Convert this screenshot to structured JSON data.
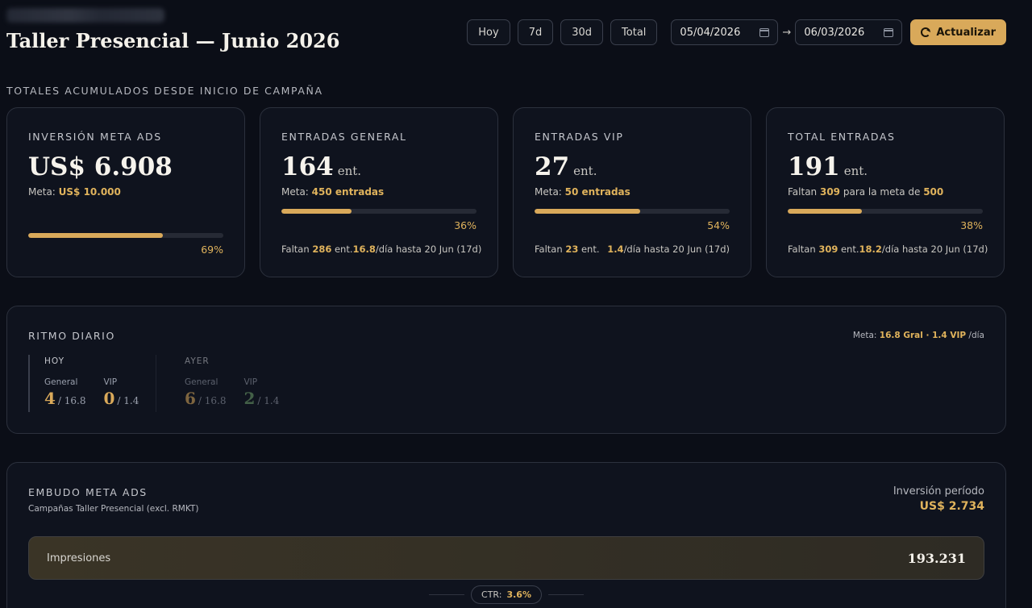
{
  "header": {
    "title": "Taller Presencial — Junio 2026",
    "range_buttons": [
      "Hoy",
      "7d",
      "30d",
      "Total"
    ],
    "date_from": "05/04/2026",
    "date_arrow": "→",
    "date_to": "06/03/2026",
    "refresh_label": "Actualizar"
  },
  "totals_label": "TOTALES ACUMULADOS DESDE INICIO DE CAMPAÑA",
  "cards": [
    {
      "label": "INVERSIÓN META ADS",
      "value": "US$ 6.908",
      "unit": "",
      "meta_prefix": "Meta: ",
      "meta_value": "US$ 10.000",
      "meta_suffix": "",
      "meta_value2": "",
      "progress": 0.69,
      "pct": "69%",
      "foot_left_prefix": "",
      "foot_left_value": "",
      "foot_left_suffix": "",
      "foot_right_value": "",
      "foot_right_suffix": ""
    },
    {
      "label": "ENTRADAS GENERAL",
      "value": "164",
      "unit": "ent.",
      "meta_prefix": "Meta: ",
      "meta_value": "450 entradas",
      "meta_suffix": "",
      "meta_value2": "",
      "progress": 0.36,
      "pct": "36%",
      "foot_left_prefix": "Faltan ",
      "foot_left_value": "286",
      "foot_left_suffix": " ent.",
      "foot_right_value": "16.8",
      "foot_right_suffix": "/día hasta 20 Jun (17d)"
    },
    {
      "label": "ENTRADAS VIP",
      "value": "27",
      "unit": "ent.",
      "meta_prefix": "Meta: ",
      "meta_value": "50 entradas",
      "meta_suffix": "",
      "meta_value2": "",
      "progress": 0.54,
      "pct": "54%",
      "foot_left_prefix": "Faltan ",
      "foot_left_value": "23",
      "foot_left_suffix": " ent.",
      "foot_right_value": "1.4",
      "foot_right_suffix": "/día hasta 20 Jun (17d)"
    },
    {
      "label": "TOTAL ENTRADAS",
      "value": "191",
      "unit": "ent.",
      "meta_prefix": "Faltan ",
      "meta_value": "309",
      "meta_suffix": " para la meta de ",
      "meta_value2": "500",
      "progress": 0.38,
      "pct": "38%",
      "foot_left_prefix": "Faltan ",
      "foot_left_value": "309",
      "foot_left_suffix": " ent.",
      "foot_right_value": "18.2",
      "foot_right_suffix": "/día hasta 20 Jun (17d)"
    }
  ],
  "ritmo": {
    "title": "RITMO DIARIO",
    "meta_prefix": "Meta: ",
    "meta_value": "16.8 Gral · 1.4 VIP",
    "meta_suffix": " /día",
    "days": [
      {
        "name": "HOY",
        "general_label": "General",
        "general_value": "4",
        "general_target": "/ 16.8",
        "vip_label": "VIP",
        "vip_value": "0",
        "vip_target": "/ 1.4"
      },
      {
        "name": "AYER",
        "general_label": "General",
        "general_value": "6",
        "general_target": "/ 16.8",
        "vip_label": "VIP",
        "vip_value": "2",
        "vip_target": "/ 1.4"
      }
    ]
  },
  "embudo": {
    "title": "EMBUDO META ADS",
    "subtitle": "Campañas Taller Presencial (excl. RMKT)",
    "investment_label": "Inversión período",
    "investment_value": "US$ 2.734",
    "stage_label": "Impresiones",
    "stage_value": "193.231",
    "ctr_label": "CTR:",
    "ctr_value": "3.6%"
  },
  "colors": {
    "background": "#0b0e17",
    "card": "#0f131e",
    "accent": "#d9a95a",
    "positive": "#6fa06a"
  }
}
